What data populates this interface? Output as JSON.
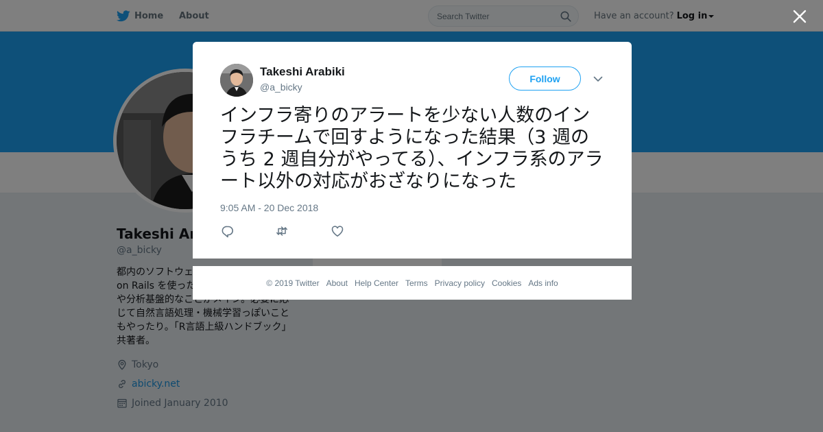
{
  "nav": {
    "home": "Home",
    "about": "About",
    "search_placeholder": "Search Twitter",
    "have_account": "Have an account?",
    "login": "Log in"
  },
  "profile": {
    "name": "Takeshi Arabiki",
    "handle": "@a_bicky",
    "bio": "都内のソフトウェアエンジニア。Ruby on Rails を使ったり、 最近はインフラや分析基盤的なことがメイン。必要に応じて自然言語処理・機械学習っぽいこともやったり。「R言語上級ハンドブック」共著者。",
    "location": "Tokyo",
    "website": "abicky.net",
    "joined": "Joined January 2010"
  },
  "tweet": {
    "author_name": "Takeshi Arabiki",
    "author_handle": "@a_bicky",
    "follow_label": "Follow",
    "text": "インフラ寄りのアラートを少ない人数のインフラチームで回すようになった結果（3 週のうち 2 週自分がやってる）、インフラ系のアラート以外の対応がおざなりになった",
    "timestamp": "9:05 AM - 20 Dec 2018"
  },
  "footer": {
    "copyright": "© 2019 Twitter",
    "links": [
      "About",
      "Help Center",
      "Terms",
      "Privacy policy",
      "Cookies",
      "Ads info"
    ]
  },
  "colors": {
    "brand": "#1da1f2",
    "link": "#1b95e0",
    "muted": "#657786"
  },
  "icons": [
    "twitter-bird-icon",
    "search-icon",
    "close-icon",
    "chevron-down-icon",
    "reply-icon",
    "retweet-icon",
    "like-icon",
    "location-icon",
    "link-icon",
    "calendar-icon"
  ]
}
